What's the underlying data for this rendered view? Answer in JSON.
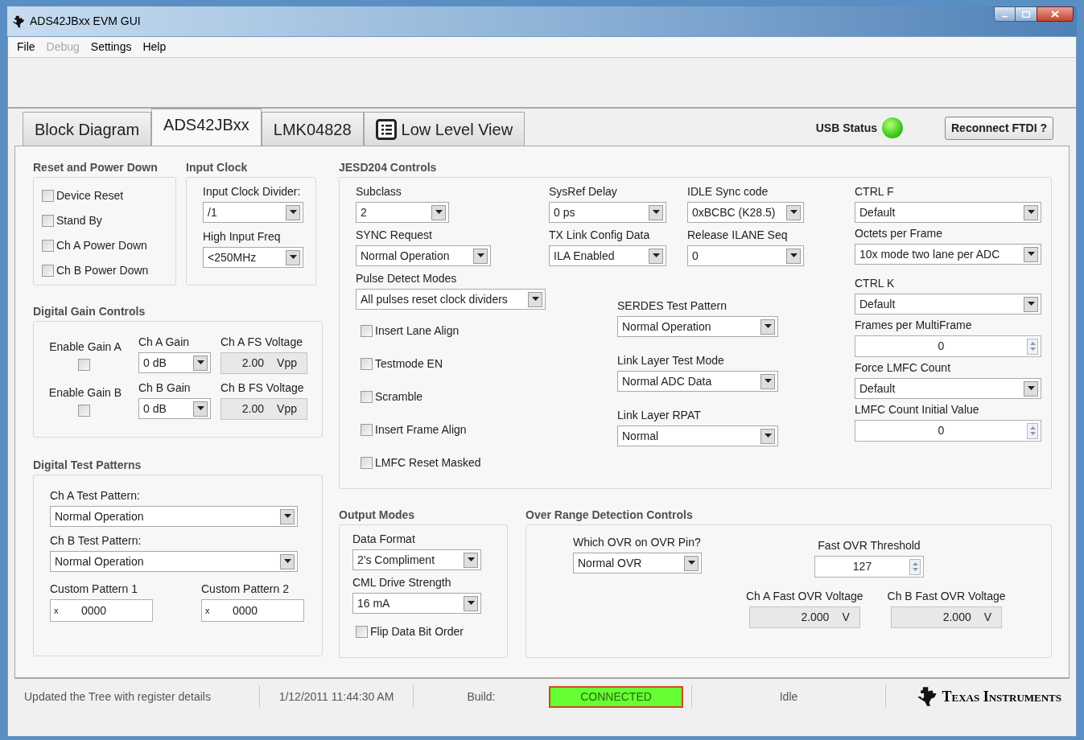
{
  "window": {
    "title": "ADS42JBxx EVM GUI"
  },
  "menu": [
    {
      "label": "File",
      "disabled": false
    },
    {
      "label": "Debug",
      "disabled": true
    },
    {
      "label": "Settings",
      "disabled": false
    },
    {
      "label": "Help",
      "disabled": false
    }
  ],
  "tabs": [
    {
      "label": "Block Diagram",
      "selected": false,
      "kind": "plain"
    },
    {
      "label": "ADS42JBxx",
      "selected": true,
      "kind": "plain"
    },
    {
      "label": "LMK04828",
      "selected": false,
      "kind": "plain"
    },
    {
      "label": "Low Level View",
      "selected": false,
      "kind": "list"
    }
  ],
  "usb_status": {
    "label": "USB Status",
    "on": true
  },
  "reconnect_button": "Reconnect FTDI ?",
  "reset_power_down": {
    "title": "Reset and Power Down",
    "checkboxes": [
      {
        "label": "Device Reset",
        "checked": false
      },
      {
        "label": "Stand By",
        "checked": false
      },
      {
        "label": "Ch A Power Down",
        "checked": false
      },
      {
        "label": "Ch B Power Down",
        "checked": false
      }
    ]
  },
  "input_clock": {
    "title": "Input Clock",
    "controls": [
      {
        "kind": "dropdown",
        "label": "Input Clock Divider:",
        "value": "/1"
      },
      {
        "kind": "dropdown",
        "label": "High Input Freq",
        "value": "<250MHz"
      }
    ]
  },
  "digital_gain": {
    "title": "Digital Gain Controls",
    "rows": [
      {
        "enable_label": "Enable Gain A",
        "enabled": false,
        "gain": {
          "kind": "dropdown",
          "label": "Ch A Gain",
          "value": "0 dB"
        },
        "fs": {
          "kind": "indicator",
          "label": "Ch A FS Voltage",
          "value": "2.00",
          "unit": "Vpp"
        }
      },
      {
        "enable_label": "Enable Gain B",
        "enabled": false,
        "gain": {
          "kind": "dropdown",
          "label": "Ch B Gain",
          "value": "0 dB"
        },
        "fs": {
          "kind": "indicator",
          "label": "Ch B FS Voltage",
          "value": "2.00",
          "unit": "Vpp"
        }
      }
    ]
  },
  "digital_test_patterns": {
    "title": "Digital Test Patterns",
    "controls": [
      {
        "kind": "dropdown",
        "label": "Ch A Test Pattern:",
        "value": "Normal Operation"
      },
      {
        "kind": "dropdown",
        "label": "Ch B Test Pattern:",
        "value": "Normal Operation"
      }
    ],
    "custom": [
      {
        "kind": "text",
        "label": "Custom Pattern 1",
        "prefix": "x",
        "value": "0000"
      },
      {
        "kind": "text",
        "label": "Custom Pattern 2",
        "prefix": "x",
        "value": "0000"
      }
    ]
  },
  "jesd204": {
    "title": "JESD204 Controls",
    "top": [
      {
        "kind": "dropdown",
        "label": "Subclass",
        "value": "2"
      },
      {
        "kind": "dropdown",
        "label": "SysRef Delay",
        "value": "0 ps"
      },
      {
        "kind": "dropdown",
        "label": "IDLE Sync code",
        "value": "0xBCBC (K28.5)"
      },
      {
        "kind": "dropdown",
        "label": "SYNC Request",
        "value": "Normal Operation"
      },
      {
        "kind": "dropdown",
        "label": "TX Link Config Data",
        "value": "ILA Enabled"
      },
      {
        "kind": "dropdown",
        "label": "Release ILANE Seq",
        "value": "0"
      }
    ],
    "pulse": {
      "kind": "dropdown",
      "label": "Pulse Detect Modes",
      "value": "All pulses reset clock dividers"
    },
    "checkboxes": [
      {
        "label": "Insert Lane Align",
        "checked": false
      },
      {
        "label": "Testmode EN",
        "checked": false
      },
      {
        "label": "Scramble",
        "checked": false
      },
      {
        "label": "Insert Frame Align",
        "checked": false
      },
      {
        "label": "LMFC Reset Masked",
        "checked": false
      }
    ],
    "serdes": [
      {
        "kind": "dropdown",
        "label": "SERDES Test Pattern",
        "value": "Normal Operation"
      },
      {
        "kind": "dropdown",
        "label": "Link Layer Test Mode",
        "value": "Normal ADC Data"
      },
      {
        "kind": "dropdown",
        "label": "Link Layer RPAT",
        "value": "Normal"
      }
    ],
    "right": [
      {
        "kind": "dropdown",
        "label": "CTRL F",
        "value": "Default"
      },
      {
        "kind": "dropdown",
        "label": "Octets per Frame",
        "value": "10x mode two lane per ADC"
      },
      {
        "kind": "dropdown",
        "label": "CTRL K",
        "value": "Default"
      },
      {
        "kind": "numeric",
        "label": "Frames per MultiFrame",
        "value": "0"
      },
      {
        "kind": "dropdown",
        "label": "Force LMFC Count",
        "value": "Default"
      },
      {
        "kind": "numeric",
        "label": "LMFC Count Initial Value",
        "value": "0"
      }
    ]
  },
  "output_modes": {
    "title": "Output Modes",
    "controls": [
      {
        "kind": "dropdown",
        "label": "Data Format",
        "value": "2's Compliment"
      },
      {
        "kind": "dropdown",
        "label": "CML Drive Strength",
        "value": "16 mA"
      }
    ],
    "checkbox": {
      "label": "Flip Data Bit Order",
      "checked": false
    }
  },
  "over_range": {
    "title": "Over Range Detection Controls",
    "ovr_pin": {
      "kind": "dropdown",
      "label": "Which OVR on OVR Pin?",
      "value": "Normal OVR"
    },
    "threshold": {
      "kind": "numeric",
      "label": "Fast OVR Threshold",
      "value": "127"
    },
    "voltages": [
      {
        "kind": "indicator",
        "label": "Ch A Fast OVR Voltage",
        "value": "2.000",
        "unit": "V"
      },
      {
        "kind": "indicator",
        "label": "Ch B Fast OVR Voltage",
        "value": "2.000",
        "unit": "V"
      }
    ]
  },
  "status_bar": {
    "message": "Updated the Tree with register details",
    "timestamp": "1/12/2011 11:44:30 AM",
    "build_label": "Build:",
    "connection": {
      "label": "CONNECTED",
      "connected": true
    },
    "state": "Idle",
    "logo": "Texas Instruments"
  }
}
